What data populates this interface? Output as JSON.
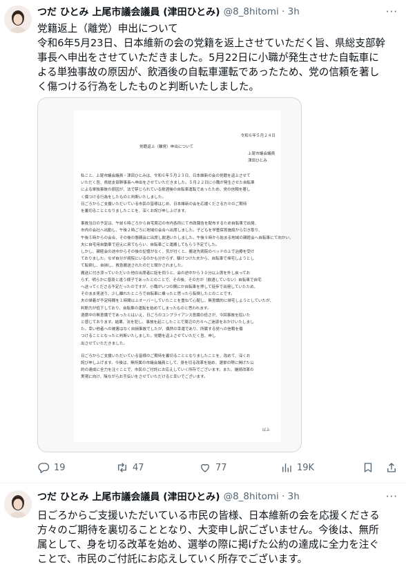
{
  "tweet1": {
    "author_name": "つだ ひとみ 上尾市議会議員 (津田ひとみ)",
    "handle": "@8_8hitomi",
    "separator": "·",
    "time": "3h",
    "more_label": "···",
    "text_lines": [
      "党籍返上（離党）申出について",
      "令和6年5月23日、日本維新の会の党籍を返上させていただく旨、県総支部幹",
      "事長へ申出をさせていただきました。5月22日に小職が発生させた自転車に",
      "よる単独事故の原因が、飲酒後の自転車運転であったため、党の信頼を著し",
      "く傷つける行為をしたものと判断いたしました。"
    ],
    "document": {
      "date": "令和６年５月２４日",
      "title": "党籍返上（離党）申出について",
      "org": "上尾市議会議員",
      "person": "津田ひとみ",
      "body_lines": [
        "私こと、上尾市議会議員・津田ひとみは、令和６年５月２３日、日本維新の会の党籍を返上させて",
        "いただく旨、県総支部幹事長へ申出をさせていただきました。５月２２日に小職が発生させた自転車",
        "による単独事故の原因が、法で禁じられている飲酒後の自転車運転であったため、党の信頼を著し",
        "く傷つける行為をしたものと判断いたしました。",
        "日ごろからご支援いただいている市民の皆様はじめ、日本維新の会を応援くださる方々のご期待",
        "を裏切ることとなりましたことを、深くお詫び申し上げます。",
        "",
        "事故当日の予定は、午前６時ごろから自宅周辺の市内各所にて市政報告を配布するため自転車で出発、",
        "市内の会社へ出勤し、午後２時ごろに地域の会合へ出席しました。子どもを学童保育施設から引き取り、",
        "午後５時からの会合、その後の懇親会に出席し飲酒いたしました。午後９時から始まる地域の親睦会へ自転車にて向かい、",
        "夫に自宅用自動車で迎えに来てもらい、自転車ごと運搬してもらう予定でした。",
        "しかし、親睦会の途中からその後の記憶がなく、気が付くと、搬送先病院のベッドの上で治療を受け",
        "ておりました。なぜ自分が病院にいるのかも分からず、駆けつけた夫から、自転車で帰宅しようとし",
        "て転倒し、自損し、救急搬送されたのだと聞かされました。",
        "搬送に付き添っていただいた他の出席者に話を伺うと、会の途中から３０分以上席を外し戻ってお",
        "らず、明らかに普段と違う様子であったとのことで、その後、その方が（飲酒していない）自転車で自宅",
        "へ送ってくださる予定だったのですが、小職がいつの間にか自転車を押して徒歩で出発していたため、",
        "そのまま見送り、少し離れたところで自転車に乗ったと思ったら転倒したとのことです。",
        "夫の帰着が予定時間を１時間以上オーバーしていたことを重ねて心配し、無意識的に帰宅しようとしていたが、",
        "判断力が低下しており、自転車の運転を始めてしまったものと思われます。",
        "酒席中の無意識でであったとはいえ、日ごろのコンプライアンス意識の低さが、今回事故を招いた",
        "と感じております。結果、法を犯し、事故を起こしたことで周辺の方々へご迷惑をおかけいたしまし",
        "た。幸い他者への被害はなく自損事故でしたが、偶然の幸運であり、所属する党への信頼を傷",
        "つけることとなったと判断いたしました。党籍を返上させていただく旨、申し",
        "出させていただきました。",
        "",
        "日ごろからご支援いただいている皆様のご期待を裏切ることとなりましたことを、改めて、深くお",
        "詫び申し上げます。今後は、無所属の市議会議員として、身を切る改革を始め、選挙の際に掲げた公",
        "約の達成に全力を注ぐことで、市民のご付託にお応えしていく所存でございます。また、継続改革の",
        "実現に向け、陰ながらお手伝いをさせていただけると幸いでございます。"
      ],
      "closing": "以上"
    },
    "actions": {
      "replies": "19",
      "retweets": "47",
      "likes": "77",
      "views": "19K"
    }
  },
  "tweet2": {
    "author_name": "つだ ひとみ 上尾市議会議員 (津田ひとみ)",
    "handle": "@8_8hitomi",
    "separator": "·",
    "time": "3h",
    "more_label": "···",
    "text_lines": [
      "日ごろからご支援いただいている市民の皆様、日本維新の会を応援くださる",
      "方々のご期待を裏切ることとなり、大変申し訳ございません。今後は、無所",
      "属として、身を切る改革を始め、選挙の際に掲げた公約の達成に全力を注ぐ",
      "ことで、市民のご付託にお応えしていく所存でございます。"
    ]
  },
  "colors": {
    "text_primary": "#0f1419",
    "text_secondary": "#536471",
    "border": "#cfd9de",
    "divider": "#eff3f4"
  },
  "icons": [
    "avatar",
    "more-icon",
    "reply-icon",
    "retweet-icon",
    "like-icon",
    "views-icon",
    "bookmark-icon",
    "share-icon"
  ]
}
